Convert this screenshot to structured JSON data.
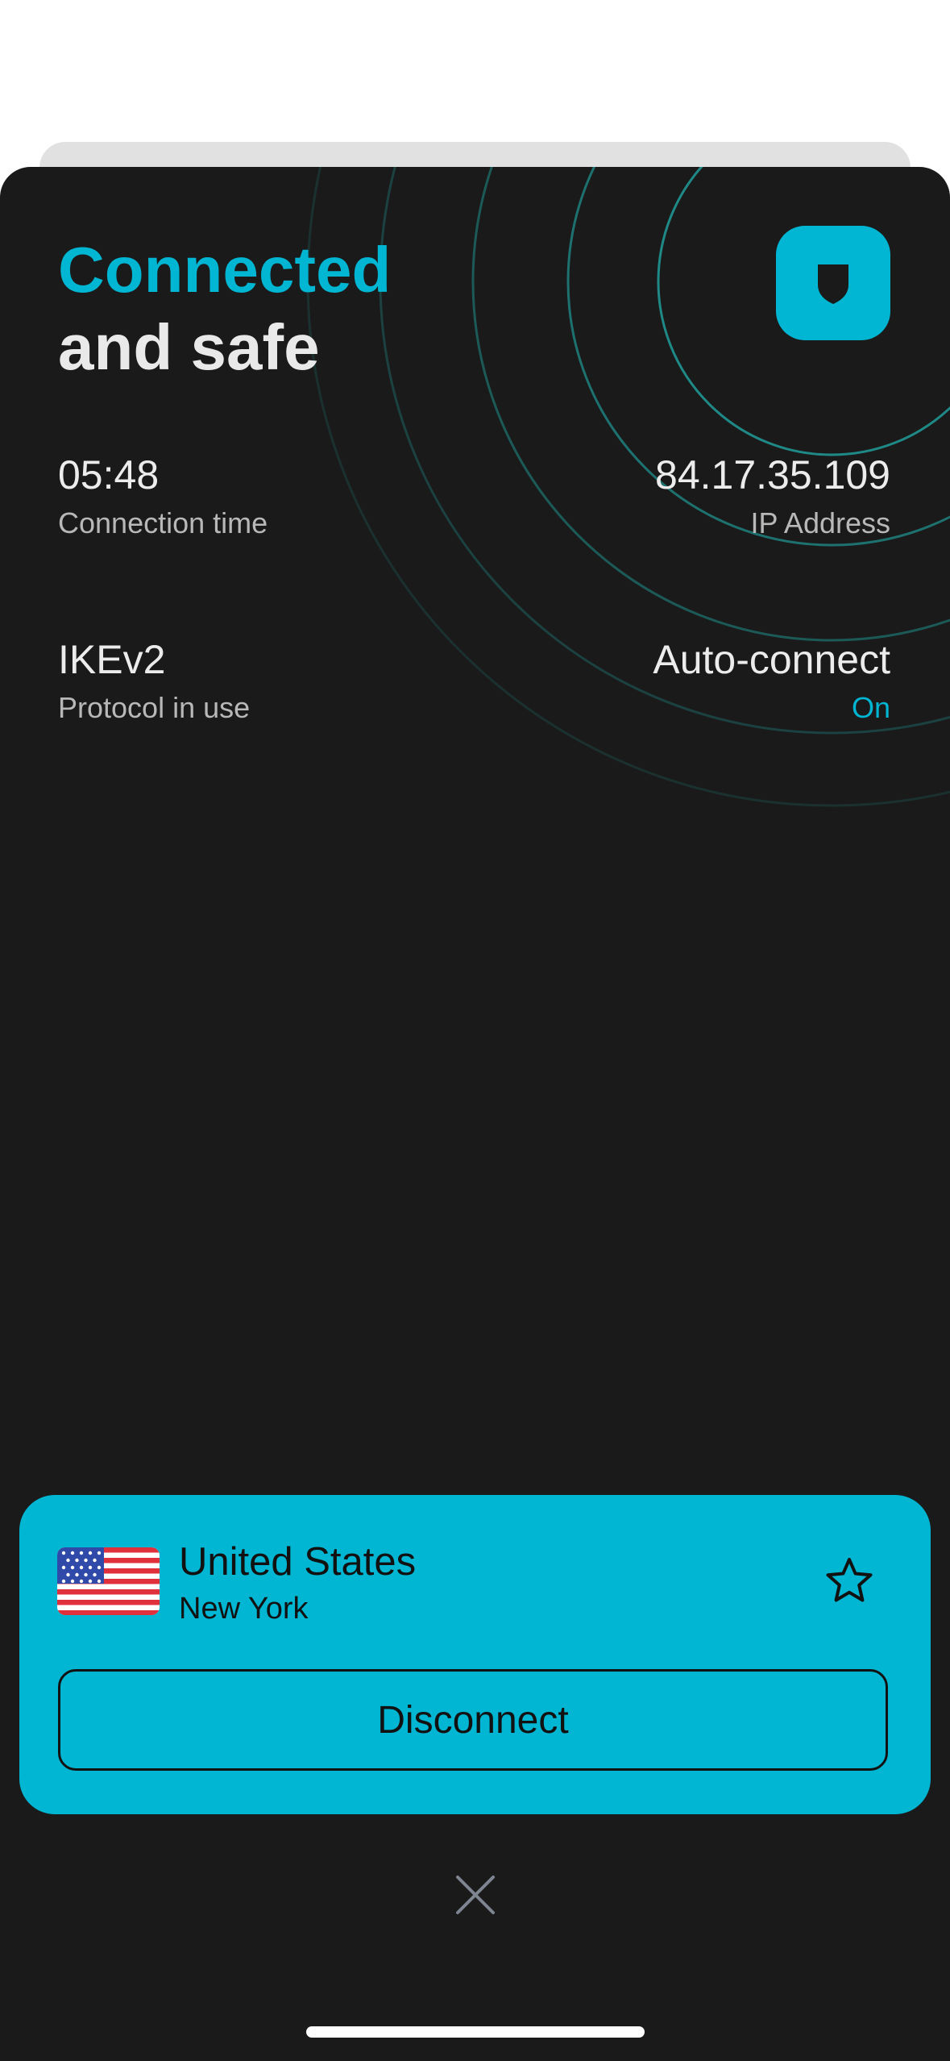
{
  "status": {
    "title_line1": "Connected",
    "title_line2": "and safe"
  },
  "stats": {
    "connection_time": {
      "value": "05:48",
      "label": "Connection time"
    },
    "ip_address": {
      "value": "84.17.35.109",
      "label": "IP Address"
    },
    "protocol": {
      "value": "IKEv2",
      "label": "Protocol in use"
    },
    "auto_connect": {
      "value": "Auto-connect",
      "label": "On"
    }
  },
  "location": {
    "country": "United States",
    "city": "New York",
    "disconnect_label": "Disconnect"
  },
  "icons": {
    "shield": "shield-icon",
    "flag": "us-flag-icon",
    "favorite": "star-icon",
    "close": "close-icon"
  },
  "colors": {
    "accent": "#00b6d2",
    "background": "#1a1a1a",
    "ring": "#1f8f8c"
  }
}
